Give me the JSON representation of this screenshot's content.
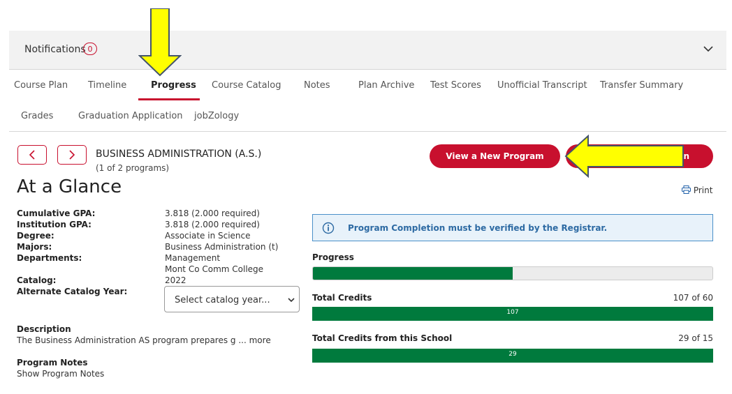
{
  "notifications": {
    "label": "Notifications",
    "count": "0"
  },
  "tabs": [
    {
      "label": "Course Plan"
    },
    {
      "label": "Timeline"
    },
    {
      "label": "Progress"
    },
    {
      "label": "Course Catalog"
    },
    {
      "label": "Notes"
    },
    {
      "label": "Plan Archive"
    },
    {
      "label": "Test Scores"
    },
    {
      "label": "Unofficial Transcript"
    },
    {
      "label": "Transfer Summary"
    },
    {
      "label": "Grades"
    },
    {
      "label": "Graduation Application"
    },
    {
      "label": "jobZology"
    }
  ],
  "program": {
    "title": "BUSINESS ADMINISTRATION (A.S.)",
    "subtitle": "(1 of 2 programs)",
    "heading": "At a Glance",
    "view_new_label": "View a New Program",
    "second_btn_visible_tail": "n",
    "print_label": "Print"
  },
  "details": {
    "cumulative_gpa_label": "Cumulative GPA:",
    "cumulative_gpa": "3.818 (2.000 required)",
    "institution_gpa_label": "Institution GPA:",
    "institution_gpa": "3.818 (2.000 required)",
    "degree_label": "Degree:",
    "degree": "Associate in Science",
    "majors_label": "Majors:",
    "majors": "Business Administration (t)",
    "departments_label": "Departments:",
    "department_1": "Management",
    "department_2": "Mont Co Comm College",
    "catalog_label": "Catalog:",
    "catalog": "2022",
    "alt_catalog_label": "Alternate Catalog Year:",
    "select_placeholder": "Select catalog year...",
    "description_label": "Description",
    "description_text": "The Business Administration AS program prepares g ... more",
    "program_notes_label": "Program Notes",
    "program_notes_link": "Show Program Notes"
  },
  "progress": {
    "info_text": "Program Completion must be verified by the Registrar.",
    "progress_label": "Progress",
    "progress_fraction": 0.5,
    "total_credits_label": "Total Credits",
    "total_credits_count": "107 of 60",
    "total_credits_value": "107",
    "school_credits_label": "Total Credits from this School",
    "school_credits_count": "29 of 15",
    "school_credits_value": "29"
  },
  "colors": {
    "brand_red": "#c8102e",
    "progress_green": "#007a3d",
    "info_blue": "#2d6aa3",
    "annotation_yellow": "#ffff00"
  }
}
